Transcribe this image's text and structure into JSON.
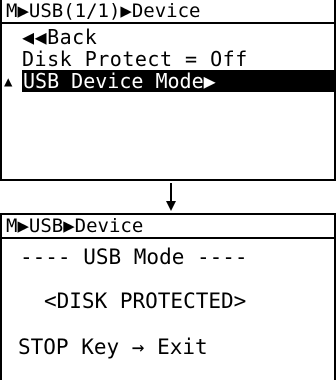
{
  "screen1": {
    "title": "M▶USB(1/1)▶Device",
    "back": "◀◀Back",
    "disk_protect": "Disk Protect  = Off",
    "usb_mode": "USB Device Mode▶",
    "cursor": "▲"
  },
  "screen2": {
    "title": "M▶USB▶Device",
    "header": "---- USB Mode ----",
    "status": "<DISK PROTECTED>",
    "hint": "STOP Key → Exit"
  }
}
